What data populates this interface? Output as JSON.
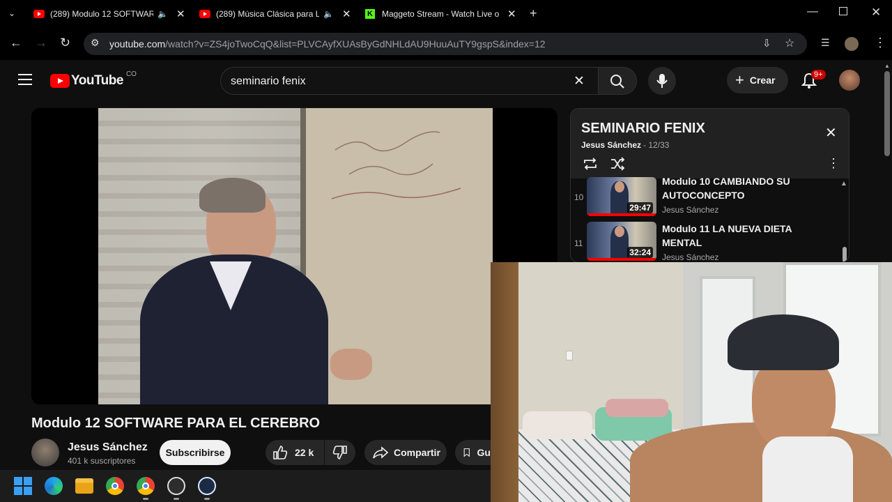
{
  "browser": {
    "tabs": [
      {
        "title": "(289) Modulo 12 SOFTWAR",
        "icon": "youtube-icon"
      },
      {
        "title": "(289) Música Clásica para Lo",
        "icon": "youtube-icon"
      },
      {
        "title": "Maggeto Stream - Watch Live o",
        "icon": "kick-icon"
      }
    ],
    "url_host": "youtube.com",
    "url_rest": "/watch?v=ZS4joTwoCqQ&list=PLVCAyfXUAsByGdNHLdAU9HuuAuTY9gspS&index=12"
  },
  "youtube": {
    "logo_text": "YouTube",
    "country": "CO",
    "search_value": "seminario fenix",
    "create_label": "Crear",
    "notifications": "9+"
  },
  "video": {
    "title": "Modulo 12 SOFTWARE PARA EL CEREBRO",
    "channel": "Jesus Sánchez",
    "subscribers": "401 k suscriptores",
    "subscribe_label": "Subscribirse",
    "likes": "22 k",
    "share_label": "Compartir",
    "save_label": "Gu"
  },
  "playlist": {
    "title": "SEMINARIO FENIX",
    "owner": "Jesus Sánchez",
    "position": "- 12/33",
    "items": [
      {
        "index": "10",
        "title": "Modulo 10 CAMBIANDO SU AUTOCONCEPTO",
        "channel": "Jesus Sánchez",
        "duration": "29:47"
      },
      {
        "index": "11",
        "title": "Modulo 11 LA NUEVA DIETA MENTAL",
        "channel": "Jesus Sánchez",
        "duration": "32:24"
      }
    ]
  },
  "colors": {
    "yt_red": "#ff0000",
    "background": "#0f0f0f",
    "kick_green": "#53fc18"
  }
}
